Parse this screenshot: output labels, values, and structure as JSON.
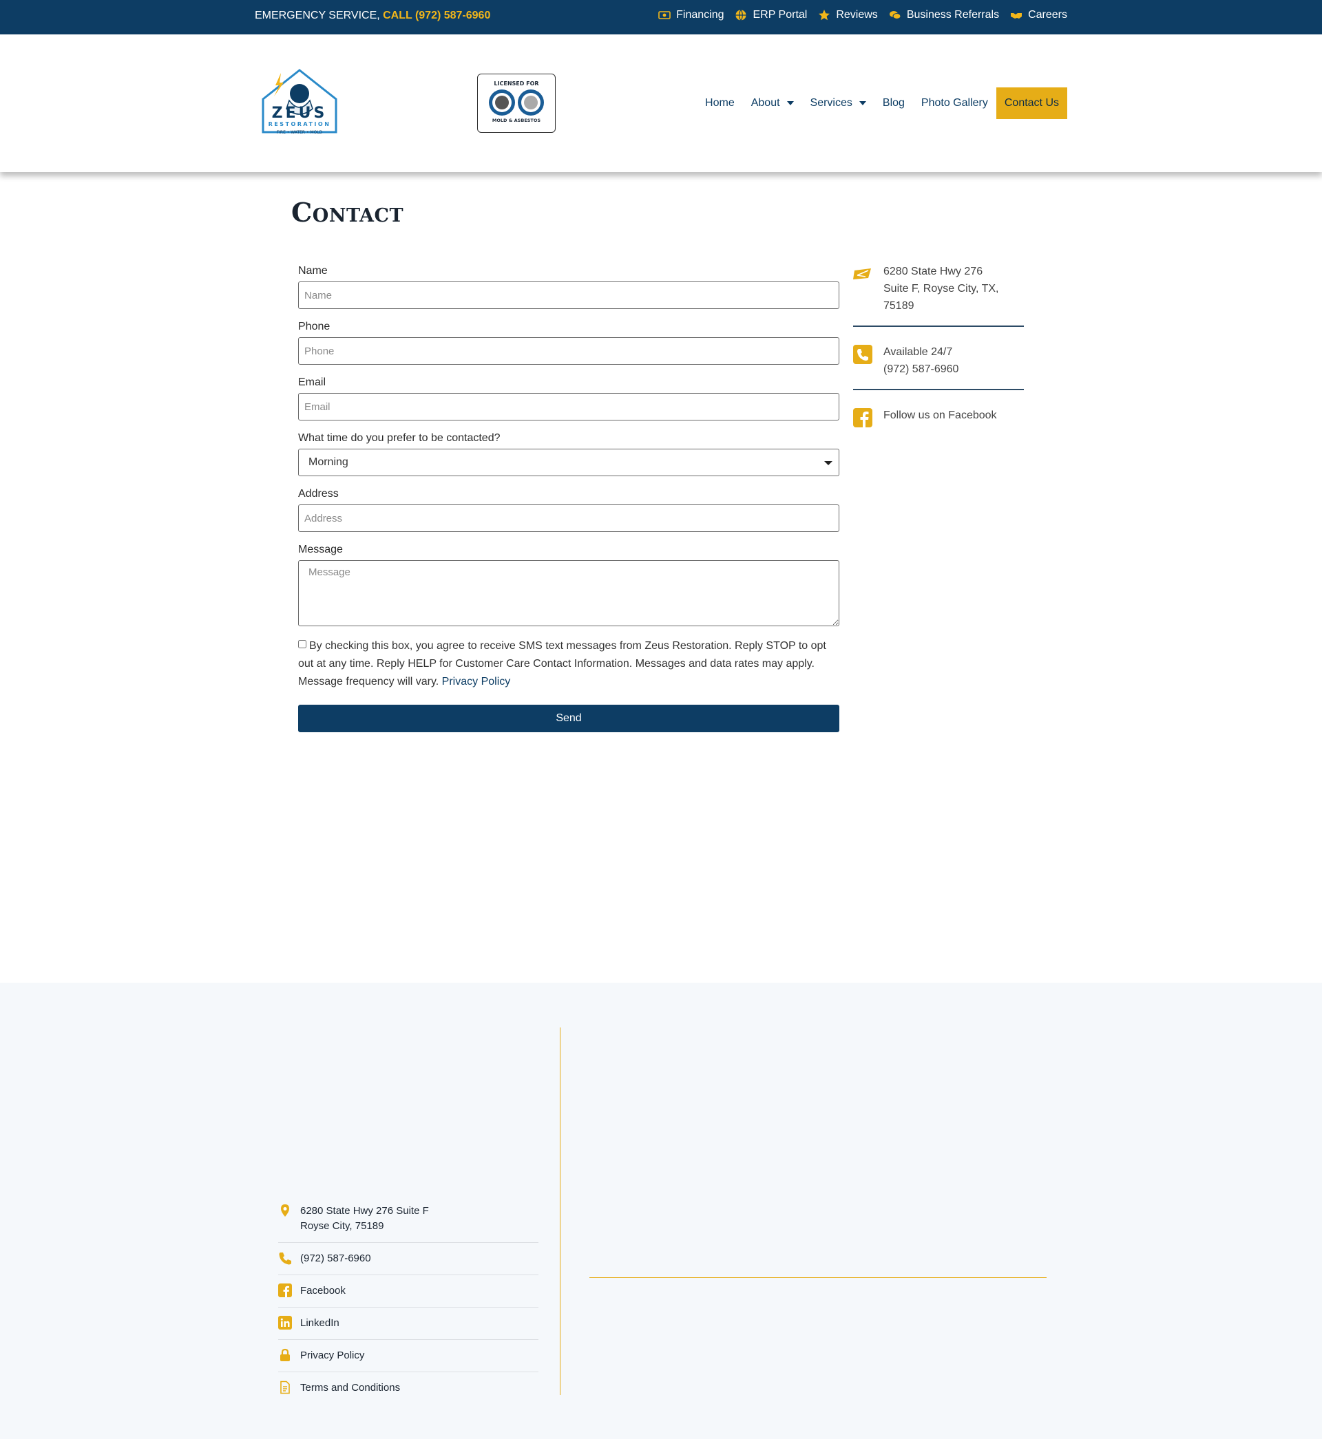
{
  "topbar": {
    "emergency_prefix": "EMERGENCY SERVICE, ",
    "emergency_call": "CALL (972) 587-6960",
    "links": [
      {
        "label": "Financing",
        "icon": "money-icon"
      },
      {
        "label": "ERP Portal",
        "icon": "globe-icon"
      },
      {
        "label": "Reviews",
        "icon": "star-icon"
      },
      {
        "label": "Business Referrals",
        "icon": "comments-icon"
      },
      {
        "label": "Careers",
        "icon": "handshake-icon"
      }
    ]
  },
  "header": {
    "logo": {
      "name": "ZEUS",
      "sub": "RESTORATION",
      "tagline": "FIRE • WATER • MOLD"
    },
    "license": {
      "top": "LICENSED FOR",
      "bottom": "MOLD & ASBESTOS"
    },
    "nav": {
      "home": "Home",
      "about": "About",
      "services": "Services",
      "blog": "Blog",
      "gallery": "Photo Gallery",
      "contact": "Contact Us"
    }
  },
  "main": {
    "title": "Contact",
    "form": {
      "name_label": "Name",
      "name_placeholder": "Name",
      "phone_label": "Phone",
      "phone_placeholder": "Phone",
      "email_label": "Email",
      "email_placeholder": "Email",
      "time_label": "What time do you prefer to be contacted?",
      "time_value": "Morning",
      "address_label": "Address",
      "address_placeholder": "Address",
      "message_label": "Message",
      "message_placeholder": "Message",
      "consent_text": "By checking this box, you agree to receive SMS text messages from Zeus Restoration. Reply STOP to opt out at any time. Reply HELP for Customer Care Contact Information. Messages and data rates may apply. Message frequency will vary. ",
      "privacy_link": "Privacy Policy",
      "send_label": "Send"
    },
    "contact_info": {
      "address_lines": [
        "6280 State Hwy 276",
        "Suite F, Royse City, TX,",
        "75189"
      ],
      "availability": "Available 24/7",
      "phone": "(972) 587-6960",
      "facebook": "Follow us on Facebook"
    }
  },
  "footer": {
    "address_line1": "6280 State Hwy 276 Suite F",
    "address_line2": "Royse City, 75189",
    "phone": "(972) 587-6960",
    "facebook": "Facebook",
    "linkedin": "LinkedIn",
    "privacy": "Privacy Policy",
    "terms": "Terms and Conditions"
  },
  "colors": {
    "navy": "#0d3d64",
    "gold": "#e6ad17",
    "footer_bg": "#f5f8fb"
  }
}
